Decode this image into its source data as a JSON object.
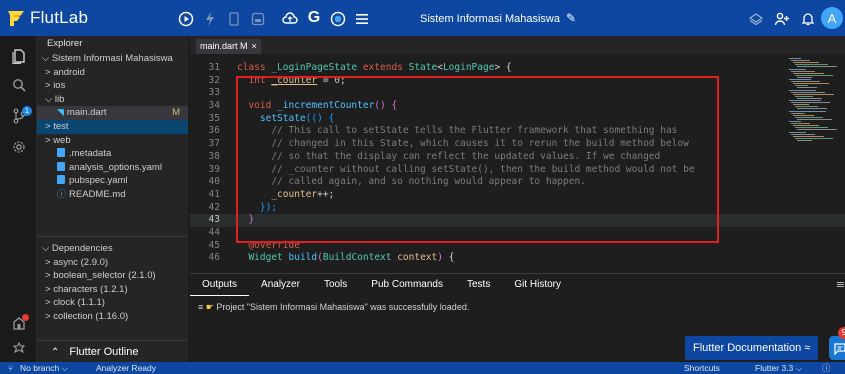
{
  "app": {
    "brand": "FlutLab"
  },
  "colors": {
    "topbar": "#0d47a1",
    "accent": "#42a5f5",
    "highlight_box": "#e02020"
  },
  "toolbar": {
    "left_icons": [
      "run-icon",
      "hot-reload-icon",
      "stop-icon",
      "device-icon"
    ],
    "right_icons": [
      "cloud-icon",
      "g-icon",
      "record-icon",
      "menu-icon"
    ]
  },
  "project": {
    "title": "Sistem Informasi Mahasiswa"
  },
  "activity_badges": {
    "git_count": "1",
    "account_dot": ""
  },
  "explorer": {
    "header": "Explorer",
    "tree": [
      {
        "label": "Sistem Informasi Mahasiswa",
        "prefix": "⌵ ",
        "indent": 1,
        "kind": "folder"
      },
      {
        "label": "android",
        "prefix": "> ",
        "indent": 2,
        "kind": "folder"
      },
      {
        "label": "ios",
        "prefix": "> ",
        "indent": 2,
        "kind": "folder"
      },
      {
        "label": "lib",
        "prefix": "⌵ ",
        "indent": 2,
        "kind": "folder"
      },
      {
        "label": "main.dart",
        "prefix": "",
        "indent": 3,
        "kind": "dart",
        "mark": "M",
        "active": true
      },
      {
        "label": "test",
        "prefix": "> ",
        "indent": 2,
        "kind": "folder",
        "selected": true
      },
      {
        "label": "web",
        "prefix": "> ",
        "indent": 2,
        "kind": "folder"
      },
      {
        "label": ".metadata",
        "prefix": "",
        "indent": 3,
        "kind": "file"
      },
      {
        "label": "analysis_options.yaml",
        "prefix": "",
        "indent": 3,
        "kind": "file"
      },
      {
        "label": "pubspec.yaml",
        "prefix": "",
        "indent": 3,
        "kind": "file"
      },
      {
        "label": "README.md",
        "prefix": "",
        "indent": 3,
        "kind": "info"
      }
    ],
    "dependencies_header": "⌵ Dependencies",
    "dependencies": [
      "async (2.9.0)",
      "boolean_selector (2.1.0)",
      "characters (1.2.1)",
      "clock (1.1.1)",
      "collection (1.16.0)"
    ],
    "outline_label": "Flutter Outline"
  },
  "editor": {
    "tab": {
      "label": "main.dart M",
      "close": "×"
    },
    "current_line": 43,
    "lines": [
      {
        "n": 31,
        "tokens": [
          [
            "k",
            "class "
          ],
          [
            "t",
            "_LoginPageState "
          ],
          [
            "k",
            "extends "
          ],
          [
            "t",
            "State"
          ],
          [
            "p",
            "<"
          ],
          [
            "t",
            "LoginPage"
          ],
          [
            "p",
            "> {"
          ]
        ]
      },
      {
        "n": 32,
        "tokens": [
          [
            "p",
            "  "
          ],
          [
            "k",
            "int "
          ],
          [
            "v-u",
            "_counter"
          ],
          [
            "p",
            " = "
          ],
          [
            "n",
            "0"
          ],
          [
            "p",
            ";"
          ]
        ]
      },
      {
        "n": 33,
        "tokens": []
      },
      {
        "n": 34,
        "tokens": [
          [
            "p",
            "  "
          ],
          [
            "k",
            "void "
          ],
          [
            "f",
            "_incrementCounter"
          ],
          [
            "brk2",
            "()"
          ],
          [
            "p",
            " "
          ],
          [
            "brk2",
            "{"
          ]
        ]
      },
      {
        "n": 35,
        "tokens": [
          [
            "p",
            "    "
          ],
          [
            "f",
            "setState"
          ],
          [
            "brk3",
            "(() {"
          ]
        ]
      },
      {
        "n": 36,
        "tokens": [
          [
            "c",
            "      // This call to setState tells the Flutter framework that something has"
          ]
        ]
      },
      {
        "n": 37,
        "tokens": [
          [
            "c",
            "      // changed in this State, which causes it to rerun the build method below"
          ]
        ]
      },
      {
        "n": 38,
        "tokens": [
          [
            "c",
            "      // so that the display can reflect the updated values. If we changed"
          ]
        ]
      },
      {
        "n": 39,
        "tokens": [
          [
            "c",
            "      // _counter without calling setState(), then the build method would not be"
          ]
        ]
      },
      {
        "n": 40,
        "tokens": [
          [
            "c",
            "      // called again, and so nothing would appear to happen."
          ]
        ]
      },
      {
        "n": 41,
        "tokens": [
          [
            "p",
            "      "
          ],
          [
            "v",
            "_counter"
          ],
          [
            "p",
            "++;"
          ]
        ]
      },
      {
        "n": 42,
        "tokens": [
          [
            "p",
            "    "
          ],
          [
            "brk3",
            "});"
          ]
        ]
      },
      {
        "n": 43,
        "tokens": [
          [
            "p",
            "  "
          ],
          [
            "brk2",
            "}"
          ]
        ]
      },
      {
        "n": 44,
        "tokens": []
      },
      {
        "n": 45,
        "tokens": [
          [
            "p",
            "  "
          ],
          [
            "anno",
            "@override"
          ]
        ]
      },
      {
        "n": 46,
        "tokens": [
          [
            "p",
            "  "
          ],
          [
            "t",
            "Widget "
          ],
          [
            "f",
            "build"
          ],
          [
            "brk2",
            "("
          ],
          [
            "t",
            "BuildContext "
          ],
          [
            "v",
            "context"
          ],
          [
            "brk2",
            ")"
          ],
          [
            "p",
            " {"
          ]
        ]
      }
    ]
  },
  "panel": {
    "tabs": [
      "Outputs",
      "Analyzer",
      "Tools",
      "Pub Commands",
      "Tests",
      "Git History"
    ],
    "active_tab": "Outputs",
    "message_prefix": "≡ ",
    "message": "Project \"Sistem Informasi Mahasiswa\" was successfully loaded.",
    "doc_button": "Flutter Documentation ≈",
    "chat_badge": "9"
  },
  "statusbar": {
    "branch": "No branch ⌵",
    "analyzer": "Analyzer Ready",
    "shortcuts": "Shortcuts",
    "flutter_version": "Flutter 3.3 ⌵",
    "help": "ⓘ"
  }
}
